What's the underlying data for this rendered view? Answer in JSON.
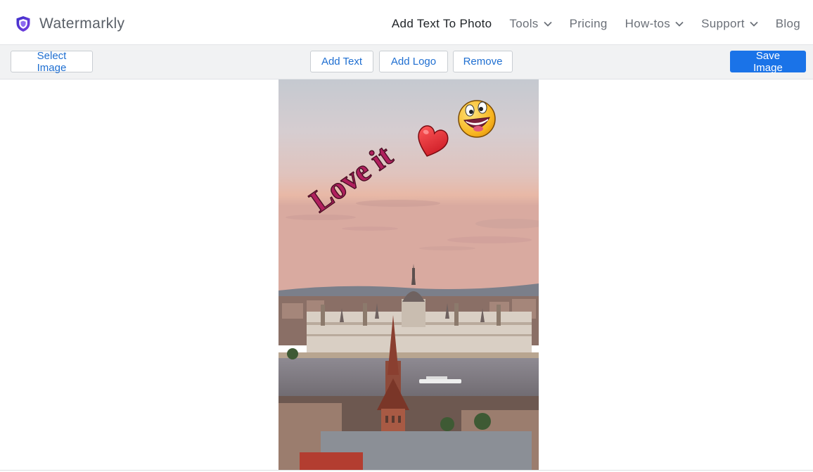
{
  "brand": {
    "name": "Watermarkly",
    "logo_icon": "shield-icon",
    "logo_color": "#5b3fd6"
  },
  "nav": {
    "items": [
      {
        "label": "Add Text To Photo",
        "active": true,
        "dropdown": false
      },
      {
        "label": "Tools",
        "active": false,
        "dropdown": true
      },
      {
        "label": "Pricing",
        "active": false,
        "dropdown": false
      },
      {
        "label": "How-tos",
        "active": false,
        "dropdown": true
      },
      {
        "label": "Support",
        "active": false,
        "dropdown": true
      },
      {
        "label": "Blog",
        "active": false,
        "dropdown": false
      }
    ]
  },
  "toolbar": {
    "select_image": "Select Image",
    "add_text": "Add Text",
    "add_logo": "Add Logo",
    "remove": "Remove",
    "save_image": "Save Image"
  },
  "canvas": {
    "watermark_text": "Love it",
    "watermark_color": "#b0205e",
    "stickers": [
      "heart-icon",
      "grinning-face-icon"
    ]
  },
  "colors": {
    "accent": "#1a73e8",
    "link": "#1f6fd1"
  }
}
